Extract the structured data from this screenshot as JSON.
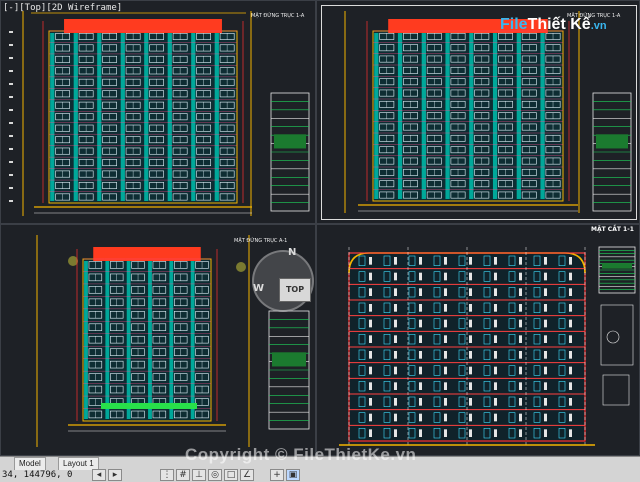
{
  "viewport_label": "[-][Top][2D Wireframe]",
  "logo": {
    "part1": "File",
    "part2": "Thiết Kế",
    "part3": ".vn"
  },
  "watermark": "Copyright © FileThietKe.vn",
  "viewcube": {
    "top_face": "TOP",
    "north": "N",
    "west": "W"
  },
  "drawing_titles": {
    "elev_tl": "MẶT ĐỨNG TRỤC 1-A",
    "elev_tr": "MẶT ĐỨNG TRỤC 1-A",
    "elev_bl": "MẶT ĐỨNG TRỤC A-1",
    "section": "MẶT CẮT 1-1"
  },
  "statusbar": {
    "coords": "34, 144796, 0",
    "tabs": [
      "Model",
      "Layout 1"
    ]
  },
  "colors": {
    "background": "#1e2126",
    "roof_red": "#ff3b1f",
    "facade_teal": "#00a89a",
    "frame_yellow": "#f3b400",
    "window_cyan": "#40e0ff"
  },
  "icons": [
    "nav-left-icon",
    "nav-right-icon",
    "grid-icon",
    "snap-icon",
    "ortho-icon",
    "polar-icon",
    "osnap-icon",
    "otrack-icon",
    "lineweight-icon",
    "quickprop-icon"
  ]
}
